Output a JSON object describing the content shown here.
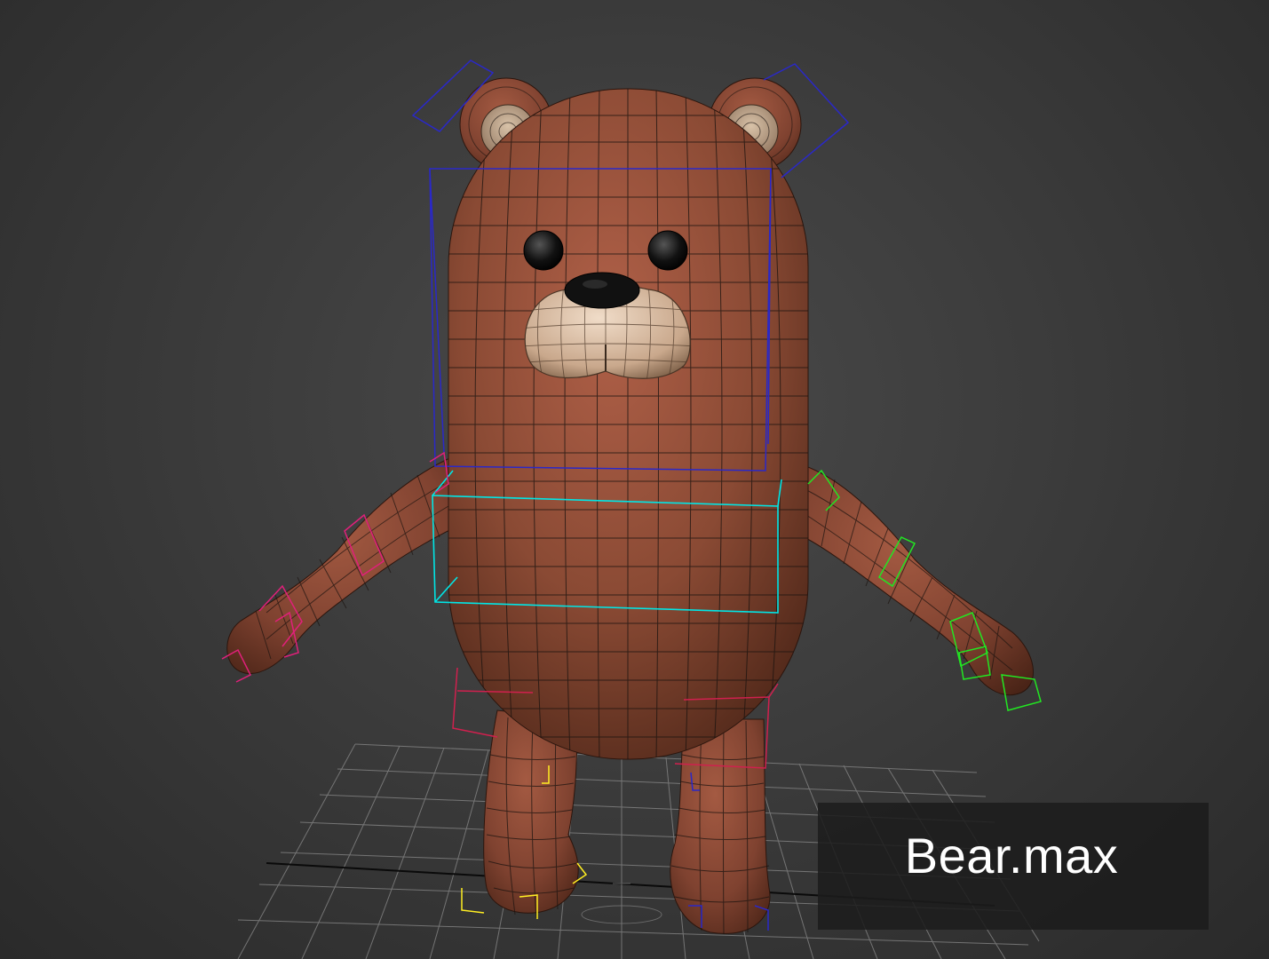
{
  "viewport": {
    "file_label": "Bear.max",
    "subject_icon": "bear-model-icon"
  },
  "colors": {
    "background": "#3c3c3c",
    "bear_fur": "#8a4a34",
    "bear_muzzle": "#d8bfa8",
    "wire": "#1c1410",
    "rig_head": "#2a28c8",
    "rig_spine": "#00e6e6",
    "rig_right_arm": "#e0207a",
    "rig_left_arm": "#22e622",
    "rig_pelvis": "#d0204e",
    "rig_feet": "#ffee22",
    "grid": "#8a8a8a",
    "label_bg": "#1c1c1c",
    "label_text": "#ffffff"
  }
}
